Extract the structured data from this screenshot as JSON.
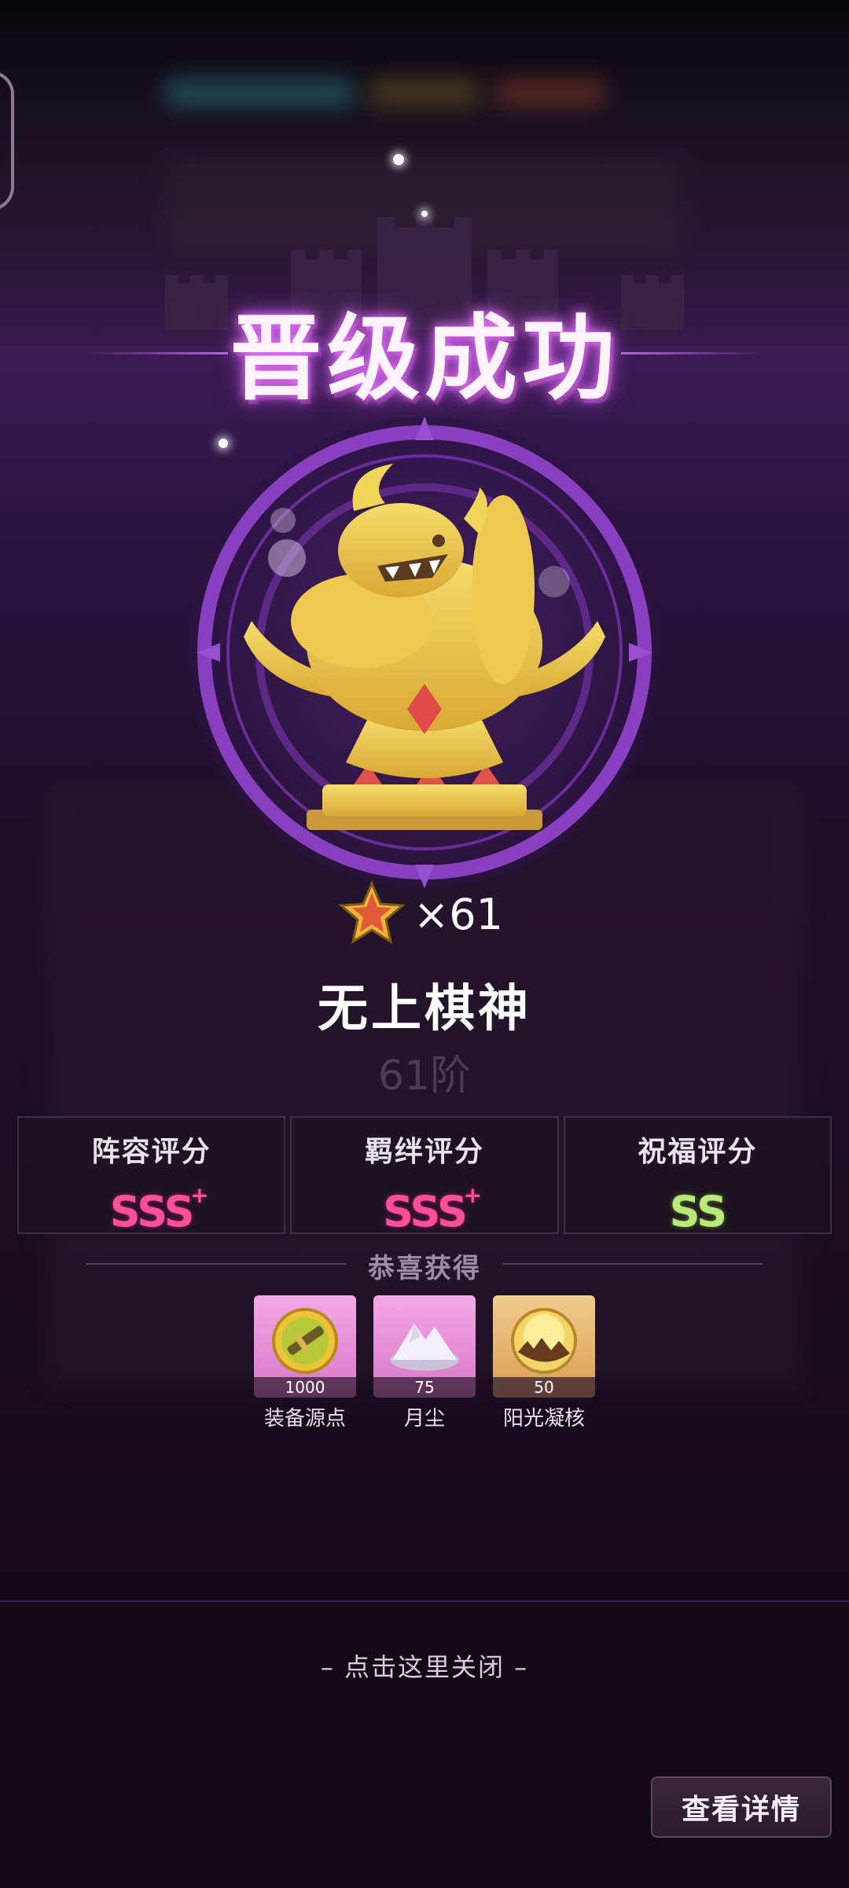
{
  "title": "晋级成功",
  "stars": {
    "multiplier": "×61"
  },
  "rank": {
    "name": "无上棋神",
    "tier": "61阶"
  },
  "scores": [
    {
      "label": "阵容评分",
      "grade": "SSS",
      "plus": "+"
    },
    {
      "label": "羁绊评分",
      "grade": "SSS",
      "plus": "+"
    },
    {
      "label": "祝福评分",
      "grade": "SS",
      "plus": ""
    }
  ],
  "rewards": {
    "header": "恭喜获得",
    "items": [
      {
        "name": "装备源点",
        "count": "1000",
        "icon": "sword-orb-icon"
      },
      {
        "name": "月尘",
        "count": "75",
        "icon": "moon-dust-icon"
      },
      {
        "name": "阳光凝核",
        "count": "50",
        "icon": "sun-core-icon"
      }
    ]
  },
  "close_hint": "– 点击这里关闭 –",
  "detail_button": "查看详情",
  "colors": {
    "accent_purple": "#8a3fc0",
    "grade_pink": "#ff4f9a",
    "grade_green": "#bbe87a",
    "trophy_gold": "#e8c24a"
  }
}
